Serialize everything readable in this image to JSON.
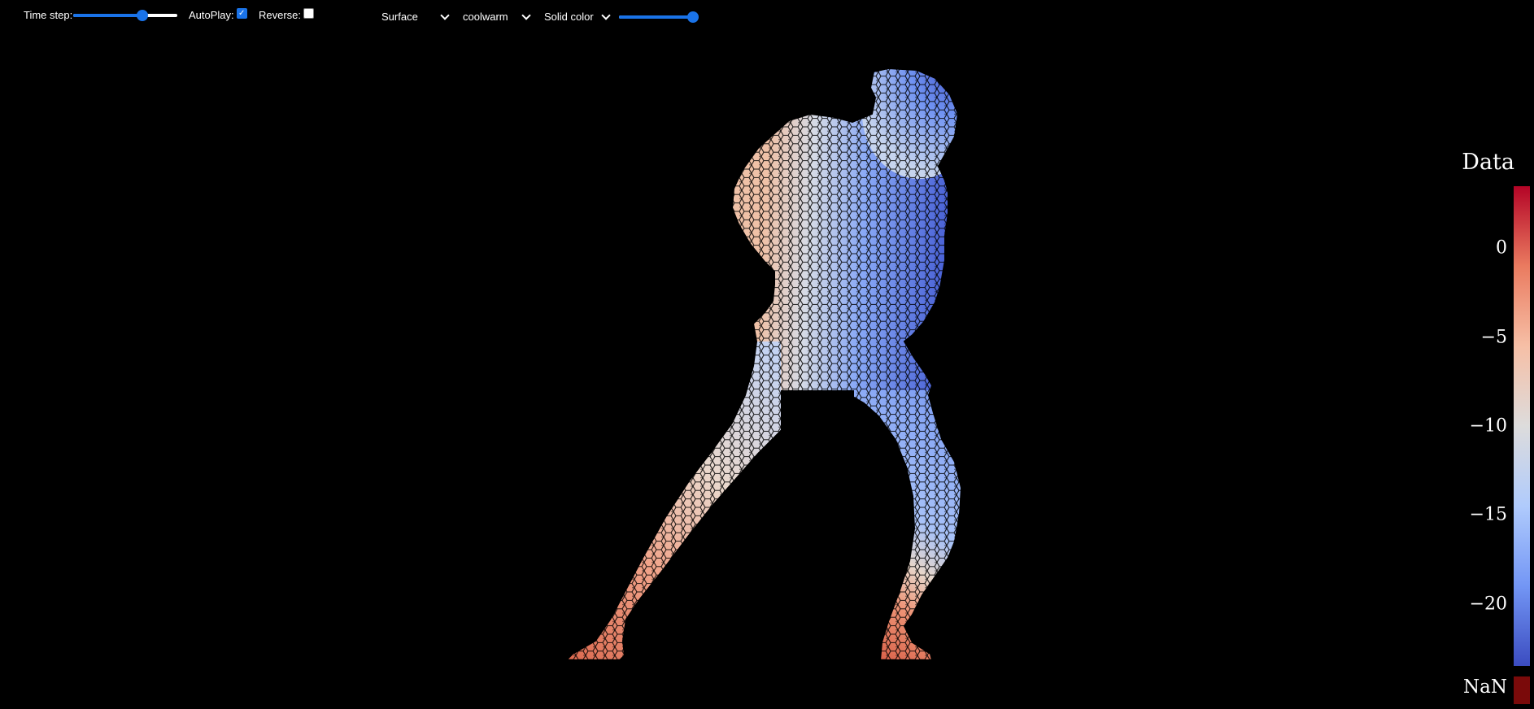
{
  "toolbar": {
    "time_step": {
      "label": "Time step:",
      "value_fraction": 0.66
    },
    "autoplay": {
      "label": "AutoPlay:",
      "checked": true
    },
    "reverse": {
      "label": "Reverse:",
      "checked": false
    },
    "representation": {
      "value": "Surface"
    },
    "colormap": {
      "value": "coolwarm"
    },
    "color_mode": {
      "value": "Solid color"
    },
    "opacity": {
      "value_fraction": 1.0
    }
  },
  "scalar_bar": {
    "title": "Data",
    "range": [
      -23.5,
      3.5
    ],
    "ticks": [
      {
        "value": 0,
        "label": "0"
      },
      {
        "value": -5,
        "label": "−5"
      },
      {
        "value": -10,
        "label": "−10"
      },
      {
        "value": -15,
        "label": "−15"
      },
      {
        "value": -20,
        "label": "−20"
      }
    ],
    "nan_label": "NaN",
    "nan_color": "#7a0a0a",
    "colormap_stops": [
      "#3b4cc0",
      "#7396f5",
      "#b0cbfc",
      "#dddcdc",
      "#f6bfa6",
      "#ea7b60",
      "#b40426"
    ]
  },
  "mesh": {
    "colormap": "coolwarm",
    "edge_color": "#000000",
    "background": "#000000"
  }
}
